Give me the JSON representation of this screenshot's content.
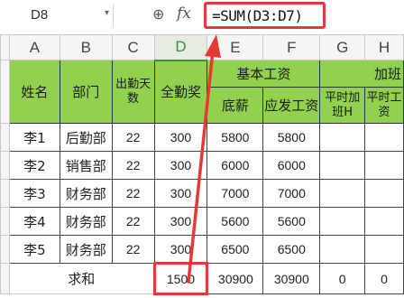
{
  "formula_bar": {
    "cell_ref": "D8",
    "zoom_icon": "zoom-icon",
    "fx_label": "fx",
    "formula": "=SUM(D3:D7)"
  },
  "columns": [
    "A",
    "B",
    "C",
    "D",
    "E",
    "F",
    "G",
    "H"
  ],
  "header": {
    "name": "姓名",
    "dept": "部门",
    "days": "出勤天数",
    "bonus": "全勤奖",
    "basic_salary": "基本工资",
    "base": "底薪",
    "payable": "应发工资",
    "overtime_group": "加班",
    "ot1": "平时加班H",
    "ot2": "平时工资"
  },
  "rows": [
    {
      "name": "李1",
      "dept": "后勤部",
      "days": "22",
      "bonus": "300",
      "base": "5800",
      "payable": "5800"
    },
    {
      "name": "李2",
      "dept": "销售部",
      "days": "22",
      "bonus": "300",
      "base": "6000",
      "payable": "6000"
    },
    {
      "name": "李3",
      "dept": "财务部",
      "days": "22",
      "bonus": "300",
      "base": "7000",
      "payable": "7000"
    },
    {
      "name": "李4",
      "dept": "财务部",
      "days": "22",
      "bonus": "300",
      "base": "5600",
      "payable": "5600"
    },
    {
      "name": "李5",
      "dept": "财务部",
      "days": "22",
      "bonus": "300",
      "base": "6500",
      "payable": "6500"
    }
  ],
  "totals": {
    "label": "求和",
    "bonus": "1500",
    "base": "30900",
    "payable": "30900",
    "g": "0",
    "h": "0"
  },
  "colors": {
    "header_fill": "#92d050",
    "highlight": "#e53935",
    "selected_col": "#3c8d3c"
  }
}
